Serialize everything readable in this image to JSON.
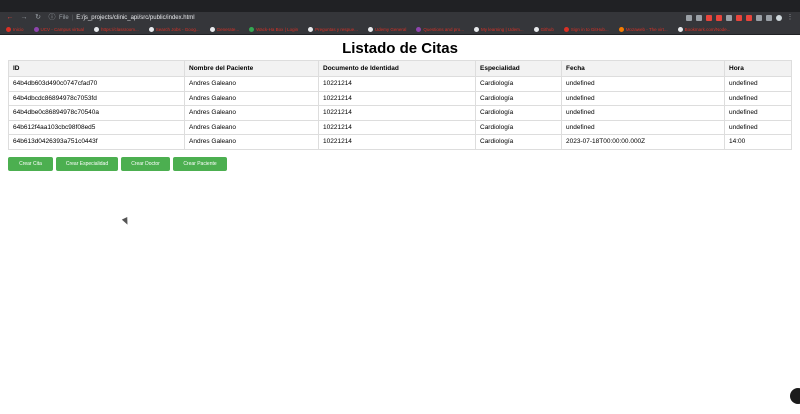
{
  "browser": {
    "url_prefix": "File",
    "url": "E:/js_projects/clinic_api/src/public/index.html",
    "bookmarks": [
      {
        "label": "Inicio",
        "color": "red"
      },
      {
        "label": "UCV - Campus virtual",
        "color": "purple"
      },
      {
        "label": "https://classroom...",
        "color": "white"
      },
      {
        "label": "Search Jobs - Goog...",
        "color": "white"
      },
      {
        "label": "Generate...",
        "color": "white"
      },
      {
        "label": "Wack-Ha Box | Login",
        "color": "green"
      },
      {
        "label": "Preguntas y respue...",
        "color": "white"
      },
      {
        "label": "Udemy General",
        "color": "white"
      },
      {
        "label": "Questions and pro...",
        "color": "purple"
      },
      {
        "label": "My learning | Udem...",
        "color": "white"
      },
      {
        "label": "Github",
        "color": "white"
      },
      {
        "label": "Sign in to GitHub...",
        "color": "red"
      },
      {
        "label": "Mozaweb - The virt...",
        "color": "orange"
      },
      {
        "label": "Bookmark.com/Node...",
        "color": "white"
      }
    ]
  },
  "page": {
    "title": "Listado de Citas"
  },
  "table": {
    "headers": [
      "ID",
      "Nombre del Paciente",
      "Documento de Identidad",
      "Especialidad",
      "Fecha",
      "Hora"
    ],
    "rows": [
      [
        "64b4db603d490c0747cfad70",
        "Andres Galeano",
        "10221214",
        "Cardiología",
        "undefined",
        "undefined"
      ],
      [
        "64b4dbcdc86894978c7053fd",
        "Andres Galeano",
        "10221214",
        "Cardiología",
        "undefined",
        "undefined"
      ],
      [
        "64b4dbe0c86894978c70540a",
        "Andres Galeano",
        "10221214",
        "Cardiología",
        "undefined",
        "undefined"
      ],
      [
        "64b612f4aa103cbc98f08ed5",
        "Andres Galeano",
        "10221214",
        "Cardiología",
        "undefined",
        "undefined"
      ],
      [
        "64b613d0426393a751c0443f",
        "Andres Galeano",
        "10221214",
        "Cardiología",
        "2023-07-18T00:00:00.000Z",
        "14:00"
      ]
    ]
  },
  "buttons": {
    "crear_cita": "Crear Cita",
    "crear_especialidad": "Crear Especialidad",
    "crear_doctor": "Crear Doctor",
    "crear_paciente": "Crear Paciente"
  }
}
